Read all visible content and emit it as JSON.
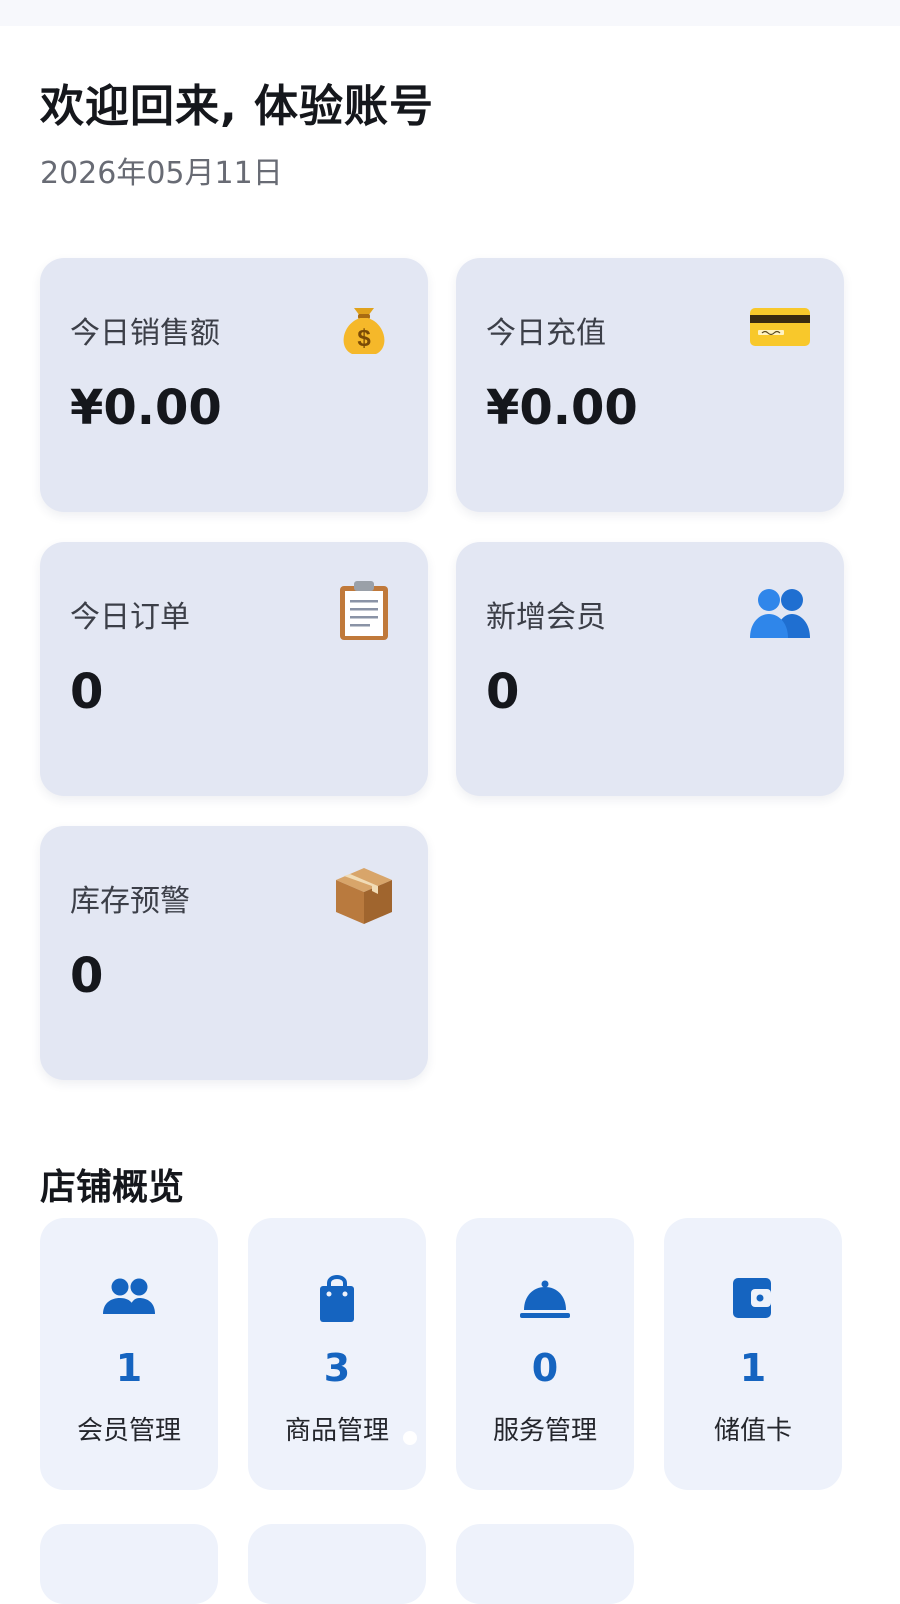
{
  "header": {
    "greeting": "欢迎回来, 体验账号",
    "date": "2026年05月11日"
  },
  "stats": [
    {
      "label": "今日销售额",
      "value": "¥0.00",
      "icon": "money-bag-icon"
    },
    {
      "label": "今日充值",
      "value": "¥0.00",
      "icon": "credit-card-icon"
    },
    {
      "label": "今日订单",
      "value": "0",
      "icon": "clipboard-icon"
    },
    {
      "label": "新增会员",
      "value": "0",
      "icon": "people-icon"
    },
    {
      "label": "库存预警",
      "value": "0",
      "icon": "package-icon"
    }
  ],
  "overview": {
    "title": "店铺概览",
    "items": [
      {
        "label": "会员管理",
        "count": "1",
        "icon": "members-icon"
      },
      {
        "label": "商品管理",
        "count": "3",
        "icon": "shopping-bag-icon"
      },
      {
        "label": "服务管理",
        "count": "0",
        "icon": "service-bell-icon"
      },
      {
        "label": "储值卡",
        "count": "1",
        "icon": "wallet-icon"
      }
    ]
  },
  "colors": {
    "accent": "#1564c0",
    "card_bg": "#e3e7f3",
    "tile_bg": "#eef2fb"
  }
}
